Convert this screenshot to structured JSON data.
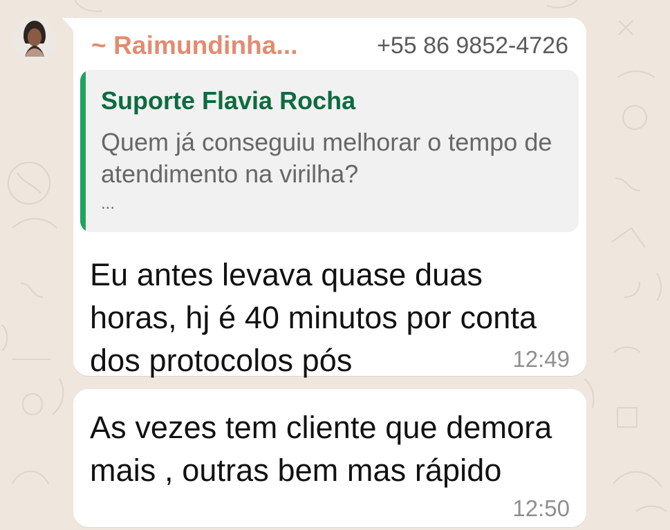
{
  "chat": {
    "messages": [
      {
        "sender_name": "~ Raimundinha...",
        "sender_phone": "+55 86 9852-4726",
        "quoted_author": "Suporte Flavia Rocha",
        "quoted_text": "Quem já conseguiu melhorar o tempo de atendimento na virilha?",
        "quoted_more": "...",
        "text": "Eu antes levava quase duas horas, hj é 40 minutos por conta dos protocolos pós",
        "time": "12:49"
      },
      {
        "text": "As vezes tem cliente que demora mais , outras bem mas rápido",
        "time": "12:50"
      }
    ]
  }
}
